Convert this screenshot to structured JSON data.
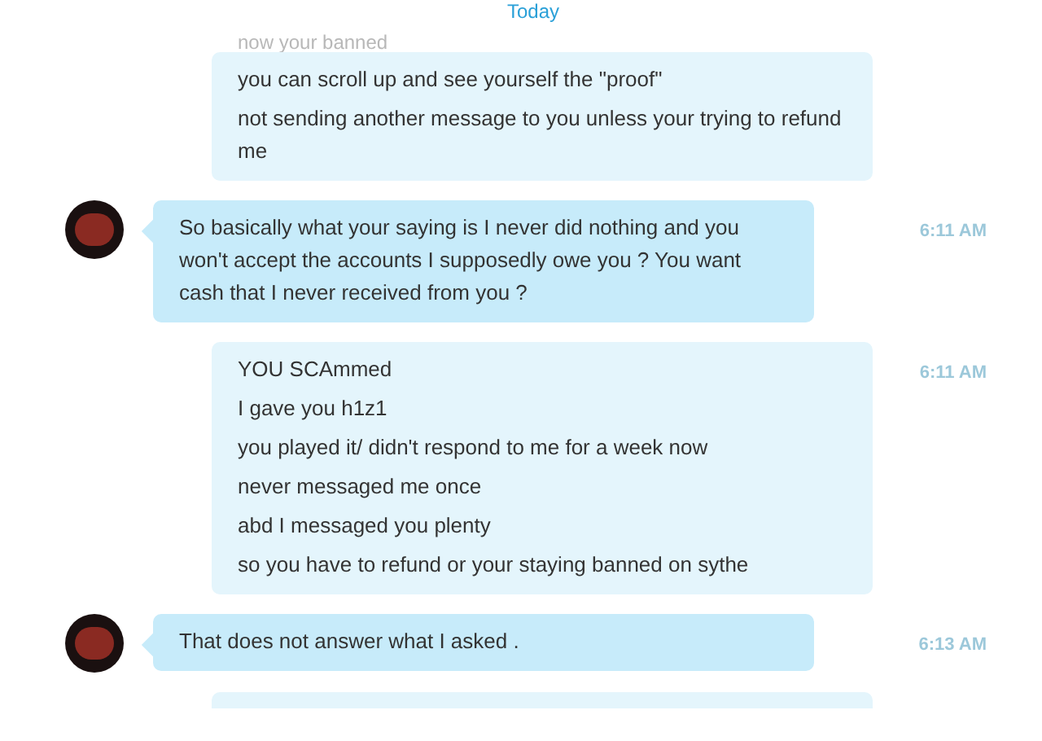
{
  "date_divider": "Today",
  "faded_line": "now your banned",
  "messages": [
    {
      "kind": "outgoing",
      "lines": [
        "you can scroll up and see yourself the \"proof\"",
        "not sending another message to you unless your trying to refund me"
      ]
    },
    {
      "kind": "incoming",
      "time": "6:11 AM",
      "lines": [
        "So basically what your saying is I never did nothing and you won't accept the accounts I supposedly owe you ? You want cash that I never received from you ?"
      ]
    },
    {
      "kind": "outgoing",
      "time": "6:11 AM",
      "lines": [
        "YOU SCAmmed",
        "I gave you h1z1",
        "you played it/ didn't respond to me for a week now",
        "never messaged me once",
        "abd I messaged you plenty",
        "so you have to refund or your staying banned on sythe"
      ]
    },
    {
      "kind": "incoming",
      "time": "6:13 AM",
      "lines": [
        "That does not answer what I asked ."
      ]
    }
  ]
}
